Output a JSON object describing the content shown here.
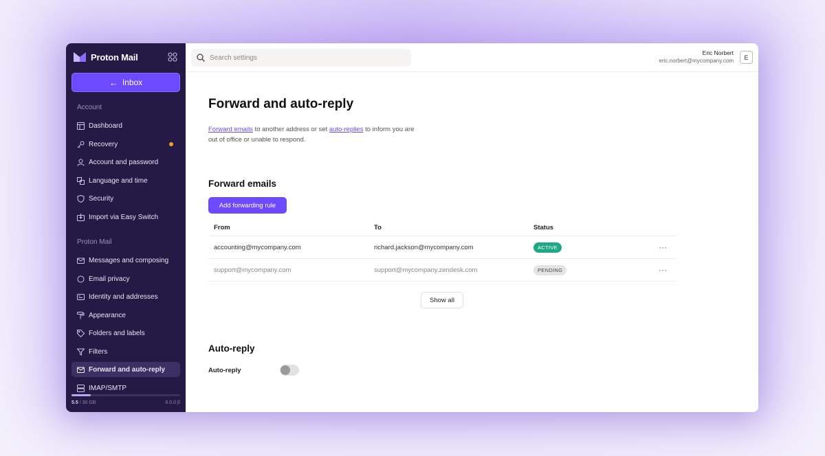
{
  "app": {
    "brand_name": "Proton Mail",
    "accent_color": "#6d4aff",
    "sidebar_color": "#241a45"
  },
  "sidebar": {
    "inbox_label": "Inbox",
    "section_account": "Account",
    "account_items": [
      {
        "label": "Dashboard",
        "icon": "dashboard-icon"
      },
      {
        "label": "Recovery",
        "icon": "key-icon",
        "has_dot": true
      },
      {
        "label": "Account and password",
        "icon": "user-icon"
      },
      {
        "label": "Language and time",
        "icon": "language-icon"
      },
      {
        "label": "Security",
        "icon": "shield-icon"
      },
      {
        "label": "Import via Easy Switch",
        "icon": "import-icon"
      }
    ],
    "section_mail": "Proton Mail",
    "mail_items": [
      {
        "label": "Messages and composing",
        "icon": "envelope-icon"
      },
      {
        "label": "Email privacy",
        "icon": "privacy-icon"
      },
      {
        "label": "Identity and addresses",
        "icon": "id-card-icon"
      },
      {
        "label": "Appearance",
        "icon": "paint-roller-icon"
      },
      {
        "label": "Folders and labels",
        "icon": "tag-icon"
      },
      {
        "label": "Filters",
        "icon": "filter-icon"
      },
      {
        "label": "Forward and auto-reply",
        "icon": "forward-envelope-icon",
        "active": true
      },
      {
        "label": "IMAP/SMTP",
        "icon": "server-icon"
      }
    ],
    "storage": {
      "used": "5.5",
      "total": "/ 30 GB",
      "fraction": 0.18
    },
    "version": "6.0.0 β"
  },
  "topbar": {
    "search_placeholder": "Search settings",
    "user_name": "Eric Norbert",
    "user_email": "eric.norbert@mycompany.com",
    "avatar_initial": "E"
  },
  "main": {
    "title": "Forward and auto-reply",
    "intro_link1": "Forward emails",
    "intro_text1": " to another address or set ",
    "intro_link2": "auto-replies",
    "intro_text2": " to inform you are out of office or unable to respond.",
    "forward_heading": "Forward emails",
    "add_rule_label": "Add forwarding rule",
    "table": {
      "headers": {
        "from": "From",
        "to": "To",
        "status": "Status"
      },
      "rows": [
        {
          "from": "accounting@mycompany.com",
          "to": "richard.jackson@mycompany.com",
          "status": "ACTIVE",
          "more": "···"
        },
        {
          "from": "support@mycompany.com",
          "to": "support@mycompany.zendesk.com",
          "status": "PENDING",
          "more": "···"
        }
      ]
    },
    "show_all_label": "Show all",
    "autoreply_heading": "Auto-reply",
    "autoreply_label": "Auto-reply",
    "autoreply_enabled": false
  }
}
